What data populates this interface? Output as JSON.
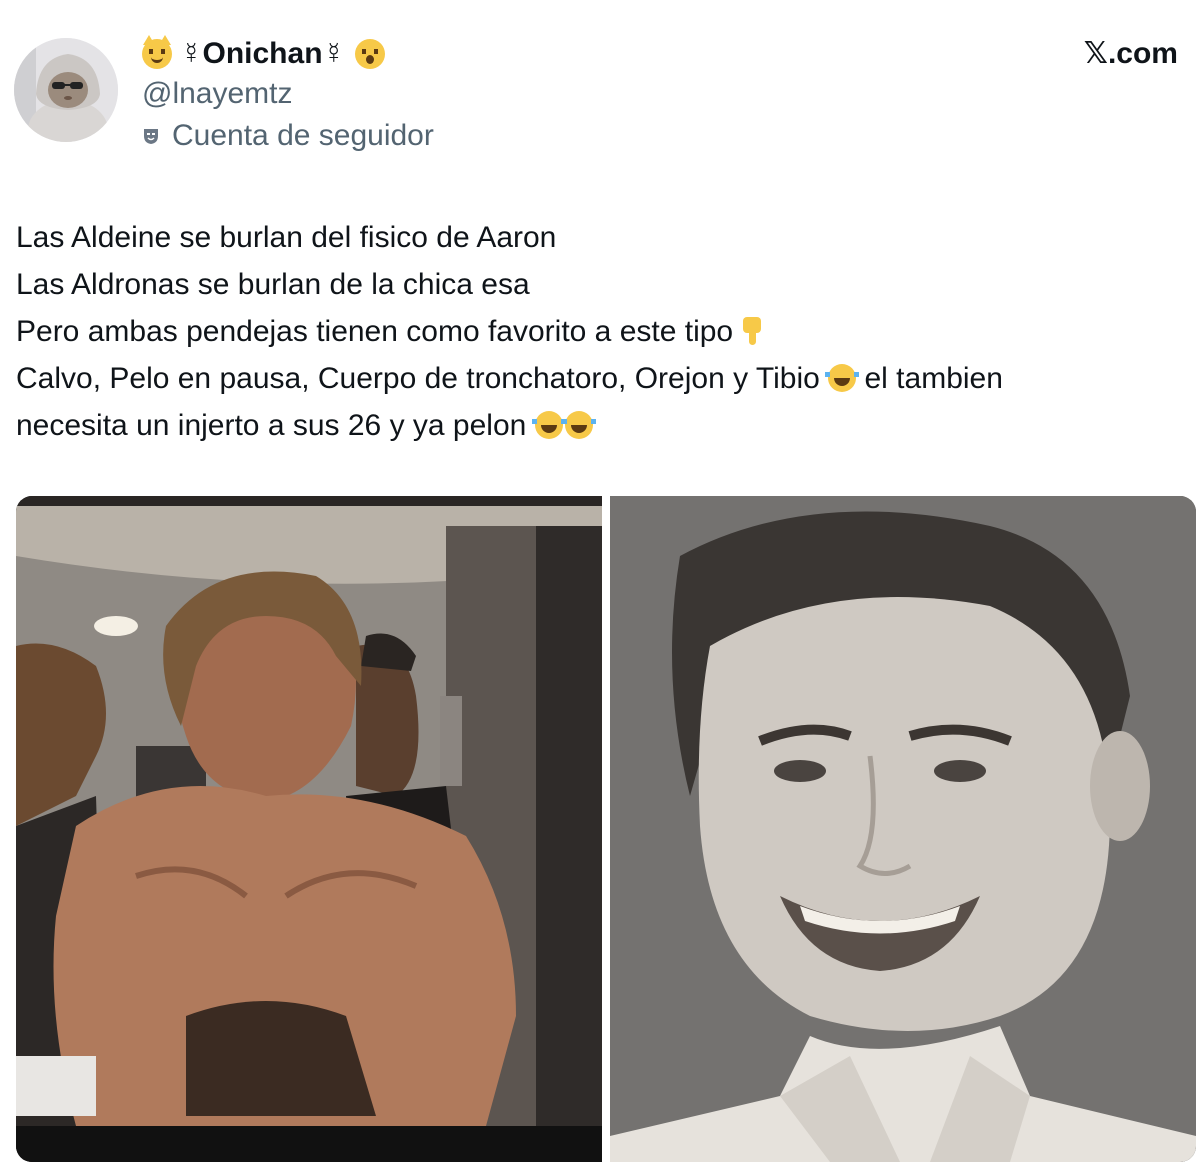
{
  "header": {
    "display_name": "☿Onichan☿",
    "handle": "@lnayemtz",
    "follower_label": "Cuenta de seguidor",
    "brand": "𝕏.com"
  },
  "icons": {
    "name_prefix": "smiling-cat-emoji",
    "name_suffix": "screaming-cat-emoji",
    "follower_badge": "theater-masks-icon",
    "pointing": "backhand-index-pointing-down-emoji",
    "laugh": "face-with-tears-of-joy-emoji"
  },
  "tweet": {
    "line1": "Las Aldeine se burlan del fisico de Aaron",
    "line2": "Las Aldronas se burlan de la chica esa",
    "line3": "Pero ambas pendejas tienen como favorito a este tipo",
    "line4a": "Calvo, Pelo en pausa, Cuerpo de tronchatoro, Orejon y Tibio",
    "line4b": "el tambien",
    "line5": "necesita un injerto a sus 26 y ya pelon"
  },
  "colors": {
    "text": "#0f1419",
    "secondary": "#536471",
    "emoji": "#f7c948"
  }
}
